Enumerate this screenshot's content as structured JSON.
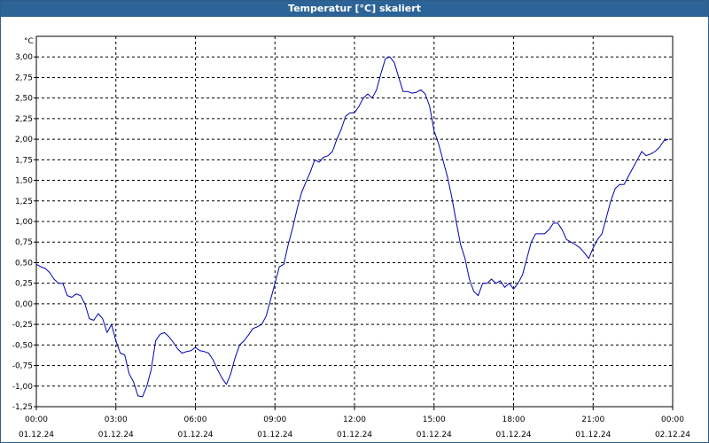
{
  "window": {
    "title": "Temperatur [°C] skaliert"
  },
  "chart_data": {
    "type": "line",
    "title": "Temperatur [°C] skaliert",
    "ylabel": "°C",
    "xlabel": "",
    "grid": true,
    "xlim": [
      "01.12.24 00:00",
      "02.12.24 00:00"
    ],
    "ylim": [
      -1.25,
      3.25
    ],
    "x_ticks": [
      {
        "time": "00:00",
        "date": "01.12.24"
      },
      {
        "time": "03:00",
        "date": "01.12.24"
      },
      {
        "time": "06:00",
        "date": "01.12.24"
      },
      {
        "time": "09:00",
        "date": "01.12.24"
      },
      {
        "time": "12:00",
        "date": "01.12.24"
      },
      {
        "time": "15:00",
        "date": "01.12.24"
      },
      {
        "time": "18:00",
        "date": "01.12.24"
      },
      {
        "time": "21:00",
        "date": "01.12.24"
      },
      {
        "time": "00:00",
        "date": "02.12.24"
      }
    ],
    "y_ticks": [
      "3,00",
      "2,75",
      "2,50",
      "2,25",
      "2,00",
      "1,75",
      "1,50",
      "1,25",
      "1,00",
      "0,75",
      "0,50",
      "0,25",
      "0,00",
      "-0,25",
      "-0,50",
      "-0,75",
      "-1,00",
      "-1,25"
    ],
    "series": [
      {
        "color": "#0000b0",
        "points": [
          [
            "00:00",
            0.48
          ],
          [
            "00:10",
            0.45
          ],
          [
            "00:20",
            0.43
          ],
          [
            "00:30",
            0.38
          ],
          [
            "00:40",
            0.3
          ],
          [
            "00:50",
            0.25
          ],
          [
            "01:00",
            0.25
          ],
          [
            "01:10",
            0.1
          ],
          [
            "01:20",
            0.08
          ],
          [
            "01:30",
            0.12
          ],
          [
            "01:40",
            0.1
          ],
          [
            "01:50",
            0.0
          ],
          [
            "02:00",
            -0.18
          ],
          [
            "02:10",
            -0.2
          ],
          [
            "02:20",
            -0.12
          ],
          [
            "02:30",
            -0.18
          ],
          [
            "02:40",
            -0.35
          ],
          [
            "02:50",
            -0.25
          ],
          [
            "03:00",
            -0.45
          ],
          [
            "03:10",
            -0.6
          ],
          [
            "03:20",
            -0.62
          ],
          [
            "03:30",
            -0.85
          ],
          [
            "03:40",
            -0.95
          ],
          [
            "03:50",
            -1.12
          ],
          [
            "04:00",
            -1.13
          ],
          [
            "04:10",
            -1.0
          ],
          [
            "04:20",
            -0.8
          ],
          [
            "04:30",
            -0.45
          ],
          [
            "04:40",
            -0.37
          ],
          [
            "04:50",
            -0.35
          ],
          [
            "05:00",
            -0.4
          ],
          [
            "05:10",
            -0.47
          ],
          [
            "05:20",
            -0.55
          ],
          [
            "05:30",
            -0.6
          ],
          [
            "05:40",
            -0.58
          ],
          [
            "05:50",
            -0.57
          ],
          [
            "06:00",
            -0.53
          ],
          [
            "06:10",
            -0.57
          ],
          [
            "06:20",
            -0.58
          ],
          [
            "06:30",
            -0.6
          ],
          [
            "06:40",
            -0.68
          ],
          [
            "06:50",
            -0.8
          ],
          [
            "07:00",
            -0.9
          ],
          [
            "07:10",
            -0.98
          ],
          [
            "07:20",
            -0.85
          ],
          [
            "07:30",
            -0.65
          ],
          [
            "07:40",
            -0.5
          ],
          [
            "07:50",
            -0.45
          ],
          [
            "08:00",
            -0.38
          ],
          [
            "08:10",
            -0.3
          ],
          [
            "08:20",
            -0.28
          ],
          [
            "08:30",
            -0.25
          ],
          [
            "08:40",
            -0.15
          ],
          [
            "08:50",
            0.05
          ],
          [
            "09:00",
            0.25
          ],
          [
            "09:10",
            0.45
          ],
          [
            "09:20",
            0.48
          ],
          [
            "09:30",
            0.72
          ],
          [
            "09:40",
            0.92
          ],
          [
            "09:50",
            1.15
          ],
          [
            "10:00",
            1.35
          ],
          [
            "10:10",
            1.48
          ],
          [
            "10:20",
            1.6
          ],
          [
            "10:30",
            1.75
          ],
          [
            "10:40",
            1.72
          ],
          [
            "10:50",
            1.78
          ],
          [
            "11:00",
            1.8
          ],
          [
            "11:10",
            1.85
          ],
          [
            "11:20",
            2.0
          ],
          [
            "11:30",
            2.12
          ],
          [
            "11:40",
            2.28
          ],
          [
            "11:50",
            2.32
          ],
          [
            "12:00",
            2.32
          ],
          [
            "12:10",
            2.4
          ],
          [
            "12:20",
            2.5
          ],
          [
            "12:30",
            2.55
          ],
          [
            "12:40",
            2.5
          ],
          [
            "12:50",
            2.6
          ],
          [
            "13:00",
            2.8
          ],
          [
            "13:10",
            2.98
          ],
          [
            "13:20",
            3.0
          ],
          [
            "13:30",
            2.93
          ],
          [
            "13:40",
            2.75
          ],
          [
            "13:50",
            2.58
          ],
          [
            "14:00",
            2.58
          ],
          [
            "14:10",
            2.56
          ],
          [
            "14:20",
            2.57
          ],
          [
            "14:30",
            2.6
          ],
          [
            "14:40",
            2.55
          ],
          [
            "14:50",
            2.4
          ],
          [
            "15:00",
            2.1
          ],
          [
            "15:10",
            1.95
          ],
          [
            "15:20",
            1.75
          ],
          [
            "15:30",
            1.55
          ],
          [
            "15:40",
            1.3
          ],
          [
            "15:50",
            1.0
          ],
          [
            "16:00",
            0.72
          ],
          [
            "16:10",
            0.55
          ],
          [
            "16:20",
            0.3
          ],
          [
            "16:30",
            0.15
          ],
          [
            "16:40",
            0.1
          ],
          [
            "16:50",
            0.25
          ],
          [
            "17:00",
            0.25
          ],
          [
            "17:10",
            0.3
          ],
          [
            "17:20",
            0.25
          ],
          [
            "17:30",
            0.28
          ],
          [
            "17:40",
            0.2
          ],
          [
            "17:50",
            0.25
          ],
          [
            "18:00",
            0.18
          ],
          [
            "18:10",
            0.25
          ],
          [
            "18:20",
            0.35
          ],
          [
            "18:30",
            0.55
          ],
          [
            "18:40",
            0.75
          ],
          [
            "18:50",
            0.85
          ],
          [
            "19:00",
            0.85
          ],
          [
            "19:10",
            0.85
          ],
          [
            "19:20",
            0.9
          ],
          [
            "19:30",
            0.98
          ],
          [
            "19:40",
            0.98
          ],
          [
            "19:50",
            0.9
          ],
          [
            "20:00",
            0.78
          ],
          [
            "20:10",
            0.75
          ],
          [
            "20:20",
            0.72
          ],
          [
            "20:30",
            0.68
          ],
          [
            "20:40",
            0.62
          ],
          [
            "20:50",
            0.55
          ],
          [
            "21:00",
            0.68
          ],
          [
            "21:10",
            0.78
          ],
          [
            "21:20",
            0.85
          ],
          [
            "21:30",
            1.05
          ],
          [
            "21:40",
            1.25
          ],
          [
            "21:50",
            1.4
          ],
          [
            "22:00",
            1.45
          ],
          [
            "22:10",
            1.45
          ],
          [
            "22:20",
            1.55
          ],
          [
            "22:30",
            1.65
          ],
          [
            "22:40",
            1.75
          ],
          [
            "22:50",
            1.85
          ],
          [
            "23:00",
            1.8
          ],
          [
            "23:10",
            1.82
          ],
          [
            "23:20",
            1.85
          ],
          [
            "23:30",
            1.9
          ],
          [
            "23:40",
            1.98
          ],
          [
            "23:50",
            2.0
          ]
        ]
      }
    ]
  }
}
